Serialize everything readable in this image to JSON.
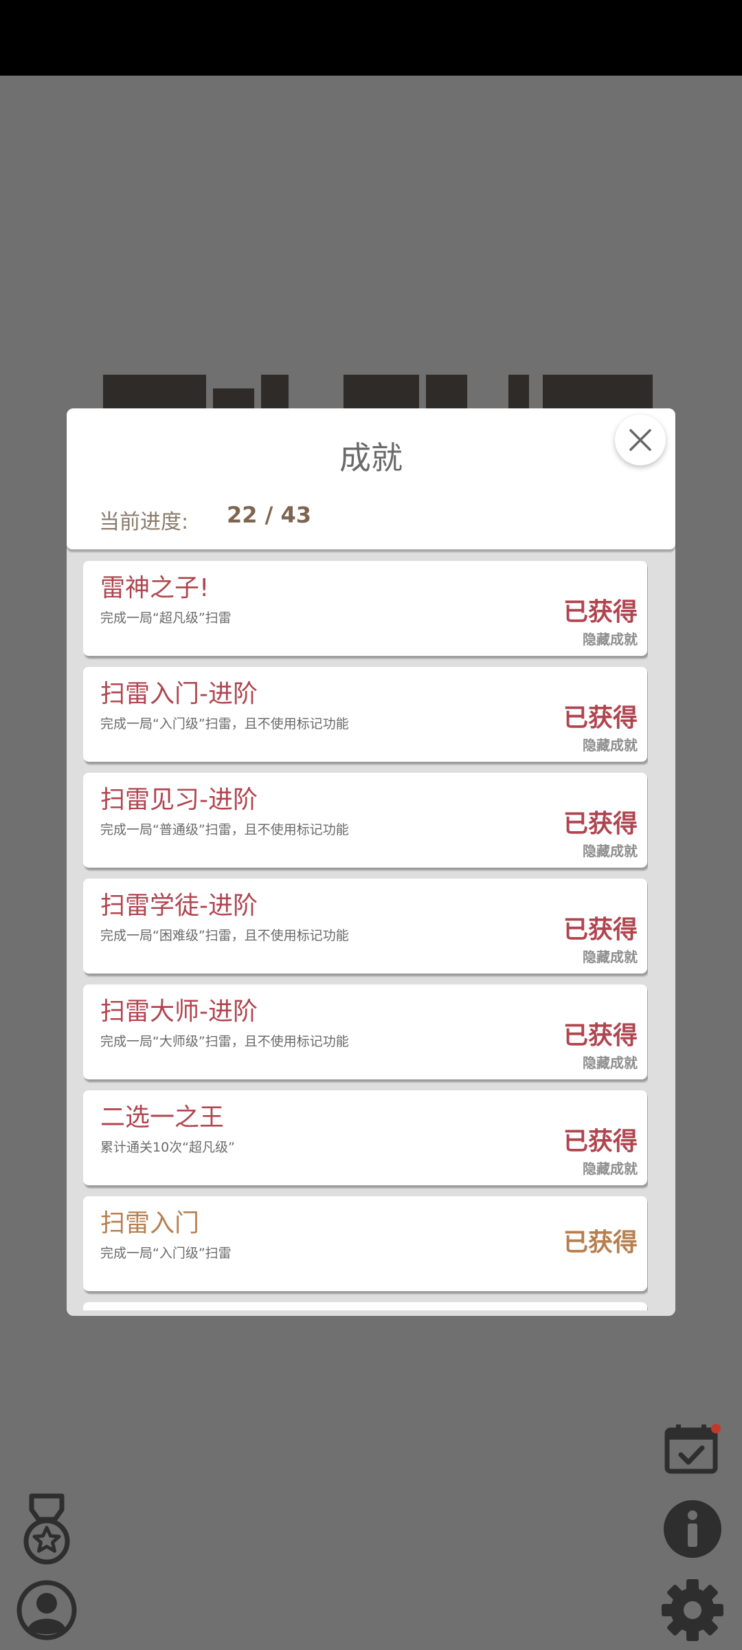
{
  "dialog": {
    "title": "成就",
    "progress_label": "当前进度:",
    "progress_value": "22 / 43"
  },
  "achievements": [
    {
      "title": "雷神之子!",
      "desc": "完成一局“超凡级”扫雷",
      "status": "已获得",
      "tag": "隐藏成就"
    },
    {
      "title": "扫雷入门-进阶",
      "desc": "完成一局“入门级”扫雷，且不使用标记功能",
      "status": "已获得",
      "tag": "隐藏成就"
    },
    {
      "title": "扫雷见习-进阶",
      "desc": "完成一局“普通级”扫雷，且不使用标记功能",
      "status": "已获得",
      "tag": "隐藏成就"
    },
    {
      "title": "扫雷学徒-进阶",
      "desc": "完成一局“困难级”扫雷，且不使用标记功能",
      "status": "已获得",
      "tag": "隐藏成就"
    },
    {
      "title": "扫雷大师-进阶",
      "desc": "完成一局“大师级”扫雷，且不使用标记功能",
      "status": "已获得",
      "tag": "隐藏成就"
    },
    {
      "title": "二选一之王",
      "desc": "累计通关10次“超凡级”",
      "status": "已获得",
      "tag": "隐藏成就"
    },
    {
      "title": "扫雷入门",
      "desc": "完成一局“入门级”扫雷",
      "status": "已获得",
      "tag": ""
    }
  ],
  "icons": {
    "close": "close-icon",
    "medal": "medal-icon",
    "profile": "profile-icon",
    "calendar": "calendar-check-icon",
    "info": "info-icon",
    "settings": "gear-icon"
  },
  "colors": {
    "accent_red": "#b0454f",
    "accent_tan": "#b77f4f",
    "overlay": "#707070",
    "notification_dot": "#c0392b"
  }
}
